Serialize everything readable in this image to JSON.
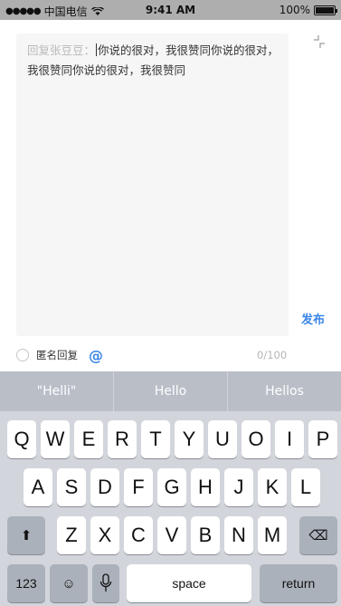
{
  "status_bar": {
    "carrier": "中国电信",
    "signal": "●●●●●",
    "time": "9:41 AM",
    "battery": "100%"
  },
  "compose": {
    "reply_prefix": "回复张豆豆：",
    "text": "你说的很对，我很赞同你说的很对，我很赞同你说的很对，我很赞同",
    "publish_label": "发布"
  },
  "options": {
    "anonymous_label": "匿名回复",
    "mention_symbol": "@",
    "counter": "0/100"
  },
  "keyboard": {
    "suggestions": [
      "\"Helli\"",
      "Hello",
      "Hellos"
    ],
    "row1": [
      "Q",
      "W",
      "E",
      "R",
      "T",
      "Y",
      "U",
      "O",
      "I",
      "P"
    ],
    "row2": [
      "A",
      "S",
      "D",
      "F",
      "G",
      "H",
      "J",
      "K",
      "L"
    ],
    "row3": [
      "Z",
      "X",
      "C",
      "V",
      "B",
      "N",
      "M"
    ],
    "numbers_label": "123",
    "space_label": "space",
    "return_label": "return",
    "emoji_icon": "☺",
    "shift_icon": "⬆",
    "backspace_icon": "⌫"
  }
}
